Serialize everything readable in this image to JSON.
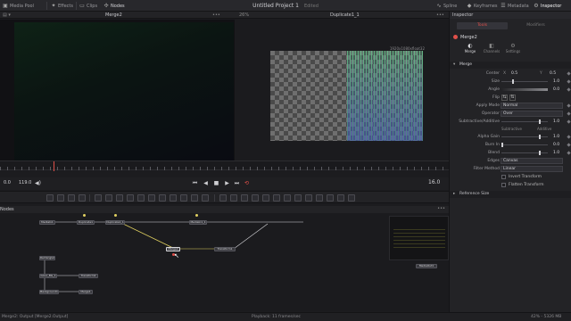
{
  "topbar": {
    "media_pool": "Media Pool",
    "effects": "Effects",
    "clips": "Clips",
    "nodes": "Nodes",
    "project_title": "Untitled Project 1",
    "edited": "Edited",
    "spline": "Spline",
    "keyframes": "Keyframes",
    "metadata": "Metadata",
    "inspector": "Inspector"
  },
  "viewer_left": {
    "name": "Merge2",
    "zoom": "26%"
  },
  "viewer_right": {
    "name": "Duplicate1_1",
    "resolution": "1920x1080xfloat32"
  },
  "transport": {
    "current": "0.0",
    "end": "119.0",
    "frame": "16.0"
  },
  "nodes_panel": {
    "title": "Nodes"
  },
  "nodes": [
    {
      "label": "MediaIn1"
    },
    {
      "label": "Duplicate1"
    },
    {
      "label": "Duplicate1_1"
    },
    {
      "label": "MediaIn1_1"
    },
    {
      "label": "Merge2"
    },
    {
      "label": "Transform1"
    },
    {
      "label": "Rectangle1"
    },
    {
      "label": "Color_BG_1"
    },
    {
      "label": "Transform2"
    },
    {
      "label": "Background1"
    },
    {
      "label": "Merge1"
    },
    {
      "label": "MediaOut1"
    }
  ],
  "inspector": {
    "title": "Inspector",
    "tab_tools": "Tools",
    "tab_modifiers": "Modifiers",
    "node_name": "Merge2",
    "subtab_merge": "Merge",
    "subtab_channels": "Channels",
    "subtab_settings": "Settings",
    "section_merge": "Merge",
    "center_label": "Center",
    "center_x_label": "X",
    "center_x": "0.5",
    "center_y_label": "Y",
    "center_y": "0.5",
    "size_label": "Size",
    "size_value": "1.0",
    "angle_label": "Angle",
    "angle_value": "0.0",
    "flip_label": "Flip",
    "apply_mode_label": "Apply Mode",
    "apply_mode_value": "Normal",
    "operator_label": "Operator",
    "operator_value": "Over",
    "sub_add_label": "Subtractive/Additive",
    "sub_add_value": "1.0",
    "subtractive": "Subtractive",
    "additive": "Additive",
    "alpha_gain_label": "Alpha Gain",
    "alpha_gain_value": "1.0",
    "burn_in_label": "Burn In",
    "burn_in_value": "0.0",
    "blend_label": "Blend",
    "blend_value": "1.0",
    "edges_label": "Edges",
    "edges_value": "Canvas",
    "filter_label": "Filter Method",
    "filter_value": "Linear",
    "invert_transform": "Invert Transform",
    "flatten_transform": "Flatten Transform",
    "section_reference": "Reference Size"
  },
  "status": {
    "left": "Merge2: Output  [Merge2.Output]",
    "playback": "Playback: 11 frames/sec",
    "right": "42% - 5326 MB"
  },
  "colors": {
    "accent_red": "#e0504a",
    "node_link_yellow": "#e0d060",
    "node_link_white": "#d8d8dc"
  }
}
